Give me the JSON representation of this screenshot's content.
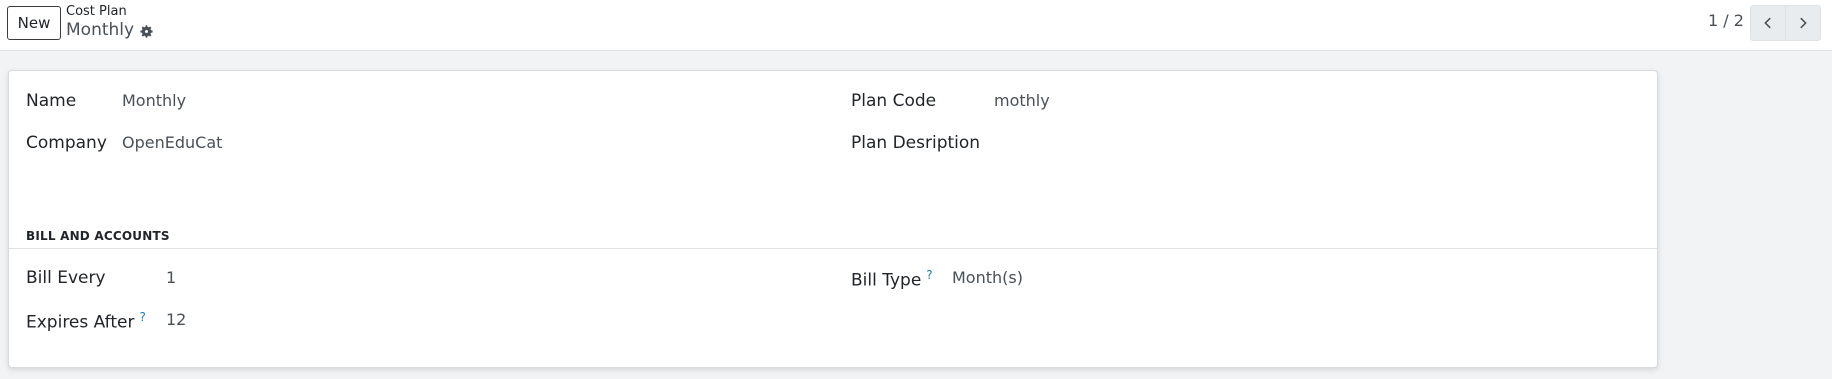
{
  "control_panel": {
    "new_button": "New",
    "breadcrumb_parent": "Cost Plan",
    "record_title": "Monthly",
    "pager_value": "1 / 2"
  },
  "form": {
    "name": {
      "label": "Name",
      "value": "Monthly"
    },
    "plan_code": {
      "label": "Plan Code",
      "value": "mothly"
    },
    "company": {
      "label": "Company",
      "value": "OpenEduCat"
    },
    "plan_description": {
      "label": "Plan Desription",
      "value": ""
    },
    "section_title": "BILL AND ACCOUNTS",
    "bill_every": {
      "label": "Bill Every",
      "value": "1"
    },
    "bill_type": {
      "label": "Bill Type",
      "value": "Month(s)"
    },
    "expires_after": {
      "label": "Expires After",
      "value": "12"
    },
    "help_marker": "?"
  },
  "colors": {
    "accent": "#1a7fb5",
    "page_background": "#f1f3f5"
  },
  "icons": [
    "gear-icon",
    "chevron-left-icon",
    "chevron-right-icon",
    "help-icon"
  ]
}
